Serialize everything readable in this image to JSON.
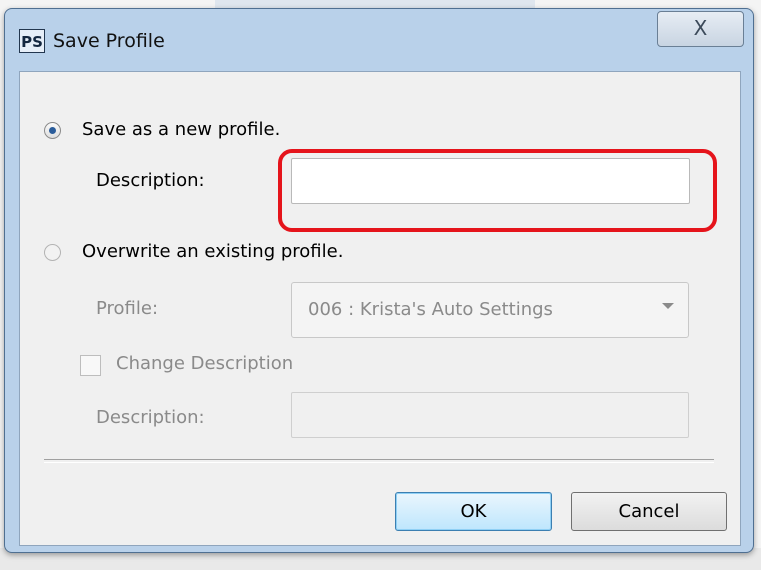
{
  "dialog": {
    "app_icon_text": "PS",
    "title": "Save Profile",
    "close_symbol": "X"
  },
  "options": {
    "new_profile_label": "Save as a new profile.",
    "new_profile_selected": true,
    "description_label": "Description:",
    "description_value": "",
    "overwrite_label": "Overwrite an existing profile.",
    "overwrite_selected": false,
    "profile_label": "Profile:",
    "profile_value": "006 : Krista's Auto Settings",
    "change_description_label": "Change Description",
    "change_description_checked": false,
    "description2_label": "Description:",
    "description2_value": ""
  },
  "buttons": {
    "ok_label": "OK",
    "cancel_label": "Cancel"
  },
  "colors": {
    "highlight": "#e5141b",
    "title_bar": "#b9d1ea"
  }
}
